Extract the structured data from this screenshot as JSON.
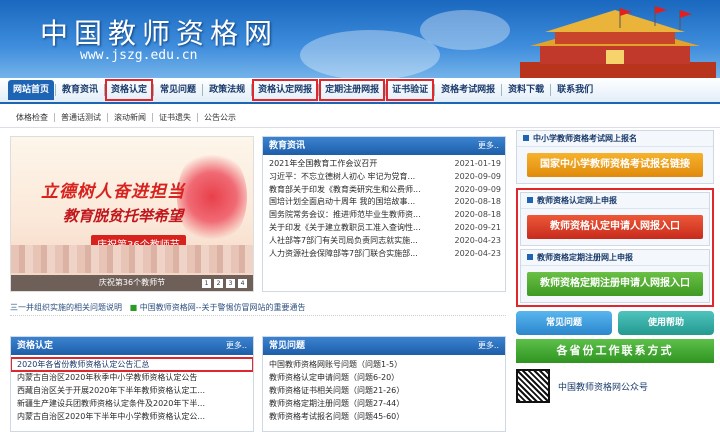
{
  "header": {
    "title": "中国教师资格网",
    "url": "www.jszg.edu.cn"
  },
  "nav": [
    "网站首页",
    "教育资讯",
    "资格认定",
    "常见问题",
    "政策法规",
    "资格认定网报",
    "定期注册网报",
    "证书验证",
    "资格考试网报",
    "资料下载",
    "联系我们"
  ],
  "subnav": [
    "体格检查",
    "普通话测试",
    "滚动新闻",
    "证书遗失",
    "公告公示"
  ],
  "slider": {
    "slogan_line1": "立德树人奋进担当",
    "slogan_line2": "教育脱贫托举希望",
    "slogan_line3": "庆祝第36个教师节",
    "caption": "庆祝第36个教师节",
    "dots": [
      "1",
      "2",
      "3",
      "4"
    ]
  },
  "news": {
    "title": "教育资讯",
    "more": "更多..",
    "items": [
      {
        "title": "2021年全国教育工作会议召开",
        "date": "2021-01-19"
      },
      {
        "title": "习近平：不忘立德树人初心 牢记为党育...",
        "date": "2020-09-09"
      },
      {
        "title": "教育部关于印发《教育类研究生和公费师...",
        "date": "2020-09-09"
      },
      {
        "title": "国培计划全面启动十周年 我的国培故事...",
        "date": "2020-08-18"
      },
      {
        "title": "国务院常务会议：推进师范毕业生教师资...",
        "date": "2020-08-18"
      },
      {
        "title": "关于印发《关于建立教职员工准入查询性...",
        "date": "2020-09-21"
      },
      {
        "title": "人社部等7部门有关司局负责同志就实施...",
        "date": "2020-04-23"
      },
      {
        "title": "人力资源社会保障部等7部门联合实施部...",
        "date": "2020-04-23"
      }
    ]
  },
  "ticker": {
    "text1": "三一并组织实施的相关问题说明",
    "text2": "中国教师资格网--关于警惕仿冒网站的重要通告"
  },
  "qualification": {
    "title": "资格认定",
    "more": "更多..",
    "items": [
      "2020年各省份教师资格认定公告汇总",
      "内蒙古自治区2020年秋季中小学教师资格认定公告",
      "西藏自治区关于开展2020年下半年教师资格认定工...",
      "新疆生产建设兵团教师资格认定条件及2020年下半...",
      "内蒙古自治区2020年下半年中小学教师资格认定公..."
    ]
  },
  "faq": {
    "title": "常见问题",
    "more": "更多..",
    "items": [
      "中国教师资格网账号问题（问题1-5）",
      "教师资格认定申请问题（问题6-20）",
      "教师资格证书相关问题（问题21-26）",
      "教师资格定期注册问题（问题27-44）",
      "教师资格考试报名问题（问题45-60）"
    ]
  },
  "right": {
    "exam_title": "中小学教师资格考试网上报名",
    "exam_button": "国家中小学教师资格考试报名链接",
    "cert_title": "教师资格认定网上申报",
    "cert_button": "教师资格认定申请人网报入口",
    "reg_title": "教师资格定期注册网上申报",
    "reg_button": "教师资格定期注册申请人网报入口",
    "faq_button": "常见问题",
    "help_button": "使用帮助",
    "contact_button": "各省份工作联系方式",
    "wechat_label": "中国教师资格网公众号"
  }
}
